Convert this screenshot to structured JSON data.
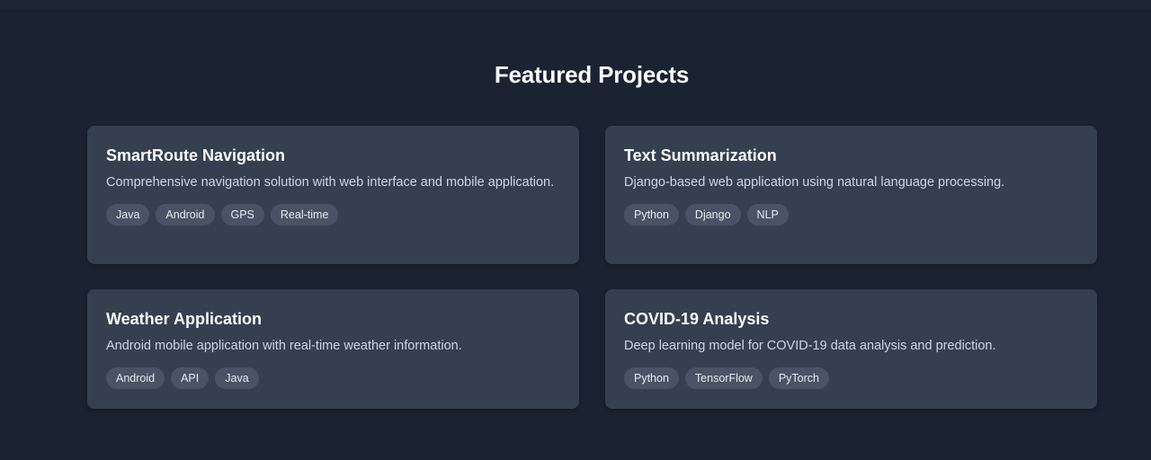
{
  "section": {
    "title": "Featured Projects"
  },
  "projects": [
    {
      "title": "SmartRoute Navigation",
      "description": "Comprehensive navigation solution with web interface and mobile application.",
      "tags": [
        "Java",
        "Android",
        "GPS",
        "Real-time"
      ]
    },
    {
      "title": "Text Summarization",
      "description": "Django-based web application using natural language processing.",
      "tags": [
        "Python",
        "Django",
        "NLP"
      ]
    },
    {
      "title": "Weather Application",
      "description": "Android mobile application with real-time weather information.",
      "tags": [
        "Android",
        "API",
        "Java"
      ]
    },
    {
      "title": "COVID-19 Analysis",
      "description": "Deep learning model for COVID-19 data analysis and prediction.",
      "tags": [
        "Python",
        "TensorFlow",
        "PyTorch"
      ]
    }
  ]
}
